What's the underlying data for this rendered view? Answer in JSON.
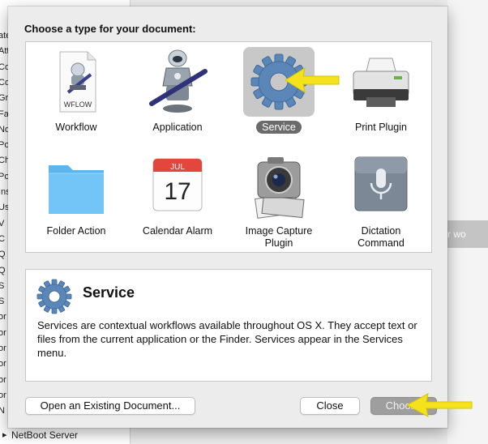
{
  "background": {
    "list_fragments": [
      "ate",
      "Att",
      "Col",
      "Cor",
      "Gri",
      "Fac",
      "Nor",
      "Por",
      "Chu",
      "Po /",
      "Ins",
      "Use",
      "V",
      "C",
      "Q",
      "Q",
      "S",
      "S",
      "or",
      "or",
      "or",
      "or",
      "or",
      "or",
      "N"
    ],
    "bottom_item": "NetBoot Server",
    "right_fragment": "r wo"
  },
  "sheet": {
    "title": "Choose a type for your document:",
    "types": [
      {
        "label": "Workflow",
        "icon": "wflow-document-icon",
        "doc_tag": "WFLOW"
      },
      {
        "label": "Application",
        "icon": "automator-robot-icon"
      },
      {
        "label": "Service",
        "icon": "gear-icon",
        "selected": true
      },
      {
        "label": "Print Plugin",
        "icon": "printer-icon"
      },
      {
        "label": "Folder Action",
        "icon": "folder-icon"
      },
      {
        "label": "Calendar Alarm",
        "icon": "calendar-icon",
        "month": "JUL",
        "day": "17"
      },
      {
        "label": "Image Capture Plugin",
        "label_line1": "Image Capture",
        "label_line2": "Plugin",
        "icon": "camera-icon"
      },
      {
        "label": "Dictation Command",
        "label_line1": "Dictation",
        "label_line2": "Command",
        "icon": "microphone-icon"
      }
    ],
    "description": {
      "title": "Service",
      "text": "Services are contextual workflows available throughout OS X. They accept text or files from the current application or the Finder. Services appear in the Services menu."
    },
    "buttons": {
      "open": "Open an Existing Document...",
      "close": "Close",
      "choose": "Choose"
    }
  },
  "colors": {
    "selection": "#c8c8c8",
    "selected_label_bg": "#6b6b6b",
    "arrow": "#f4e21c",
    "choose_disabled": "#9e9e9e"
  }
}
